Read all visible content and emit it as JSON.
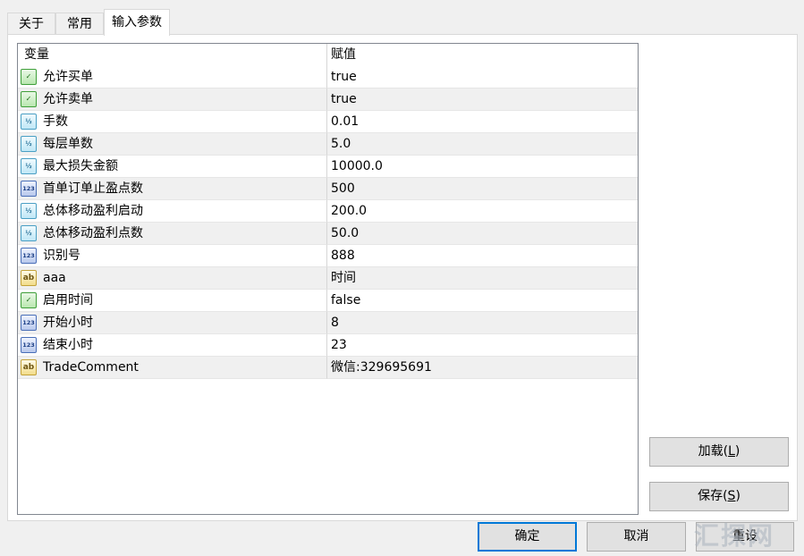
{
  "tabs": [
    {
      "label": "关于"
    },
    {
      "label": "常用"
    },
    {
      "label": "输入参数"
    }
  ],
  "grid": {
    "headers": {
      "name": "变量",
      "value": "赋值"
    },
    "rows": [
      {
        "type": "bool",
        "icon": "bool-icon",
        "name": "允许买单",
        "value": "true"
      },
      {
        "type": "bool",
        "icon": "bool-icon",
        "name": "允许卖单",
        "value": "true"
      },
      {
        "type": "double",
        "icon": "double-icon",
        "name": "手数",
        "value": "0.01"
      },
      {
        "type": "double",
        "icon": "double-icon",
        "name": "每层单数",
        "value": "5.0"
      },
      {
        "type": "double",
        "icon": "double-icon",
        "name": "最大损失金额",
        "value": "10000.0"
      },
      {
        "type": "int",
        "icon": "int-icon",
        "name": "首单订单止盈点数",
        "value": "500"
      },
      {
        "type": "double",
        "icon": "double-icon",
        "name": "总体移动盈利启动",
        "value": "200.0"
      },
      {
        "type": "double",
        "icon": "double-icon",
        "name": "总体移动盈利点数",
        "value": "50.0"
      },
      {
        "type": "int",
        "icon": "int-icon",
        "name": "识别号",
        "value": "888"
      },
      {
        "type": "string",
        "icon": "string-icon",
        "name": "aaa",
        "value": "时间"
      },
      {
        "type": "bool",
        "icon": "bool-icon",
        "name": "启用时间",
        "value": "false"
      },
      {
        "type": "int",
        "icon": "int-icon",
        "name": "开始小时",
        "value": "8"
      },
      {
        "type": "int",
        "icon": "int-icon",
        "name": "结束小时",
        "value": "23"
      },
      {
        "type": "string",
        "icon": "string-icon",
        "name": "TradeComment",
        "value": "微信:329695691"
      }
    ]
  },
  "icon_glyphs": {
    "bool": "✓",
    "double": "½",
    "int": "123",
    "string": "ab"
  },
  "side_buttons": {
    "load": {
      "label": "加载(",
      "mnemonic": "L",
      "suffix": ")"
    },
    "save": {
      "label": "保存(",
      "mnemonic": "S",
      "suffix": ")"
    }
  },
  "bottom_buttons": {
    "ok": "确定",
    "cancel": "取消",
    "reset": "重设"
  },
  "watermark": "汇探网",
  "colors": {
    "accent": "#0078d7",
    "alt_row": "#f0f0f0",
    "button_bg": "#e1e1e1"
  }
}
